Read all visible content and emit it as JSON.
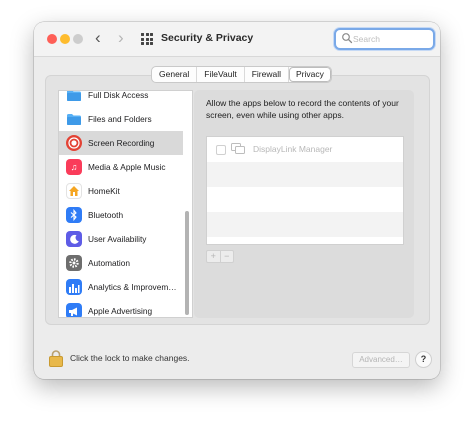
{
  "window": {
    "title": "Security & Privacy"
  },
  "nav": {
    "back_glyph": "‹",
    "forward_glyph": "›"
  },
  "search": {
    "placeholder": "Search",
    "value": ""
  },
  "tabs": [
    {
      "label": "General",
      "active": false
    },
    {
      "label": "FileVault",
      "active": false
    },
    {
      "label": "Firewall",
      "active": false
    },
    {
      "label": "Privacy",
      "active": true
    }
  ],
  "sidebar": {
    "items": [
      {
        "label": "Full Disk Access",
        "icon": "folder-icon",
        "color": "#4aa3f0"
      },
      {
        "label": "Files and Folders",
        "icon": "folder-icon",
        "color": "#4aa3f0"
      },
      {
        "label": "Screen Recording",
        "icon": "record-icon",
        "color": "#e34234",
        "selected": true
      },
      {
        "label": "Media & Apple Music",
        "icon": "music-note-icon",
        "color": "#fa3c5a"
      },
      {
        "label": "HomeKit",
        "icon": "home-icon",
        "color": "#ffffff"
      },
      {
        "label": "Bluetooth",
        "icon": "bluetooth-icon",
        "color": "#2f7cf6"
      },
      {
        "label": "User Availability",
        "icon": "moon-icon",
        "color": "#5e5ce6"
      },
      {
        "label": "Automation",
        "icon": "gear-icon",
        "color": "#6e6e6e"
      },
      {
        "label": "Analytics & Improvem…",
        "icon": "bar-chart-icon",
        "color": "#2f7cf6"
      },
      {
        "label": "Apple Advertising",
        "icon": "megaphone-icon",
        "color": "#2f7cf6"
      }
    ]
  },
  "main": {
    "description": "Allow the apps below to record the contents of your screen, even while using other apps.",
    "apps": [
      {
        "name": "DisplayLink Manager",
        "checked": false
      }
    ],
    "add_glyph": "+",
    "remove_glyph": "−"
  },
  "footer": {
    "lock_text": "Click the lock to make changes.",
    "advanced_label": "Advanced…",
    "help_label": "?"
  }
}
